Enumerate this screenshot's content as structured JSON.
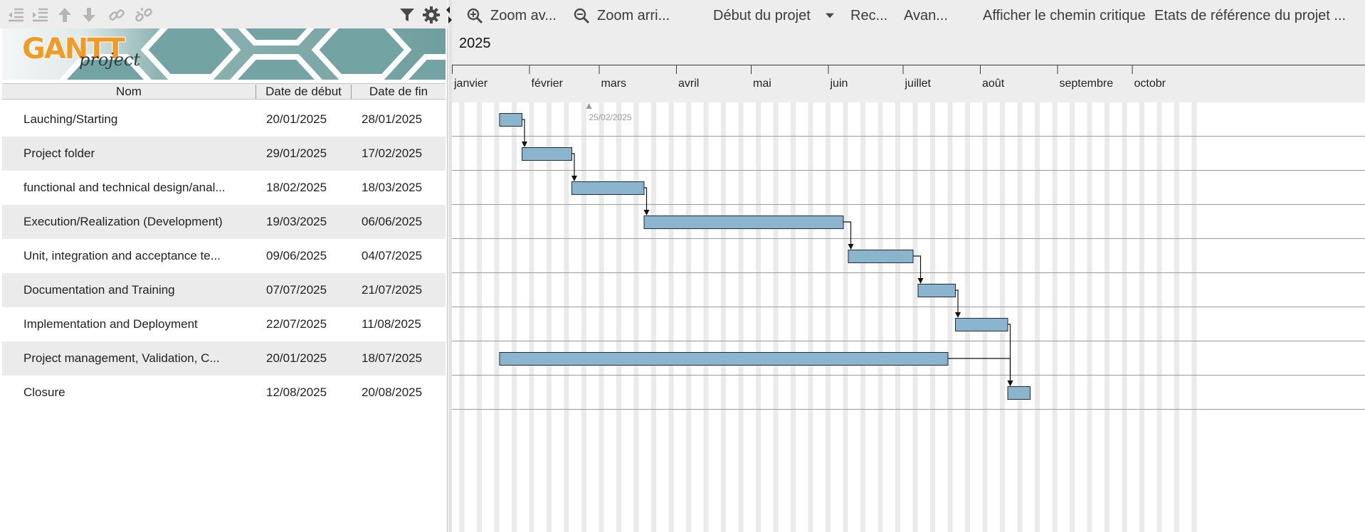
{
  "app": {
    "logo_text": "GANTT",
    "logo_sub": "project"
  },
  "left_toolbar": {
    "icons": [
      "outdent-icon",
      "indent-icon",
      "move-up-icon",
      "move-down-icon",
      "link-icon",
      "unlink-icon",
      "filter-icon",
      "settings-gear-icon"
    ]
  },
  "table": {
    "columns": {
      "name": "Nom",
      "start": "Date de début",
      "end": "Date de fin"
    },
    "rows": [
      {
        "name": "Lauching/Starting",
        "start": "20/01/2025",
        "end": "28/01/2025"
      },
      {
        "name": "Project folder",
        "start": "29/01/2025",
        "end": "17/02/2025"
      },
      {
        "name": "functional and technical design/anal...",
        "start": "18/02/2025",
        "end": "18/03/2025"
      },
      {
        "name": "Execution/Realization (Development)",
        "start": "19/03/2025",
        "end": "06/06/2025"
      },
      {
        "name": "Unit, integration and acceptance te...",
        "start": "09/06/2025",
        "end": "04/07/2025"
      },
      {
        "name": "Documentation and Training",
        "start": "07/07/2025",
        "end": "21/07/2025"
      },
      {
        "name": "Implementation and Deployment",
        "start": "22/07/2025",
        "end": "11/08/2025"
      },
      {
        "name": "Project management, Validation, C...",
        "start": "20/01/2025",
        "end": "18/07/2025"
      },
      {
        "name": "Closure",
        "start": "12/08/2025",
        "end": "20/08/2025"
      }
    ]
  },
  "chart_toolbar": {
    "zoom_in": "Zoom av...",
    "zoom_out": "Zoom arri...",
    "project_start": "Début du projet",
    "prev": "Rec...",
    "next": "Avan...",
    "critical_path": "Afficher le chemin critique",
    "baselines": "Etats de référence du projet ..."
  },
  "timeline": {
    "year": "2025",
    "months": [
      "janvier",
      "février",
      "mars",
      "avril",
      "mai",
      "juin",
      "juillet",
      "août",
      "septembre",
      "octobr"
    ],
    "today_marker": "25/02/2025"
  },
  "colors": {
    "bar_fill": "#8bb4cf",
    "bar_stroke": "#1f2c38",
    "weekend_stripe": "#ebebeb",
    "toolbar_bg": "#ededed"
  },
  "dependencies": [
    {
      "from": 0,
      "to": 1
    },
    {
      "from": 1,
      "to": 2
    },
    {
      "from": 2,
      "to": 3
    },
    {
      "from": 3,
      "to": 4
    },
    {
      "from": 4,
      "to": 5
    },
    {
      "from": 5,
      "to": 6
    },
    {
      "from": 6,
      "to": 8
    },
    {
      "from": 7,
      "to": 8
    }
  ]
}
